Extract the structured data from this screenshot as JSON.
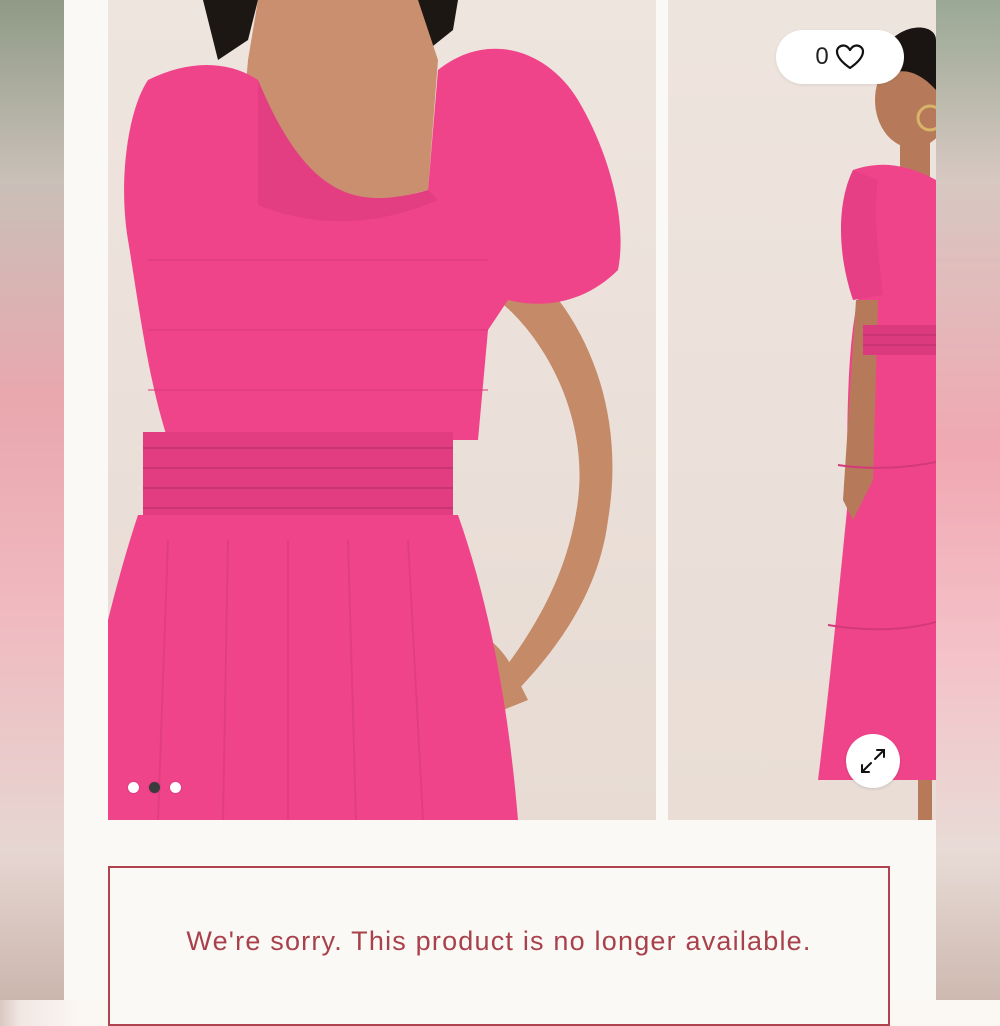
{
  "gallery": {
    "images": [
      {
        "name": "front-view"
      },
      {
        "name": "back-view"
      }
    ],
    "dots": [
      {
        "active": false
      },
      {
        "active": true
      },
      {
        "active": false
      }
    ]
  },
  "wishlist": {
    "count": "0",
    "icon": "heart-icon"
  },
  "expand": {
    "icon": "expand-icon"
  },
  "notice": {
    "message": "We're sorry. This product is no longer available."
  },
  "colors": {
    "dress_pink": "#f0448a",
    "notice_red": "#a8414b"
  }
}
